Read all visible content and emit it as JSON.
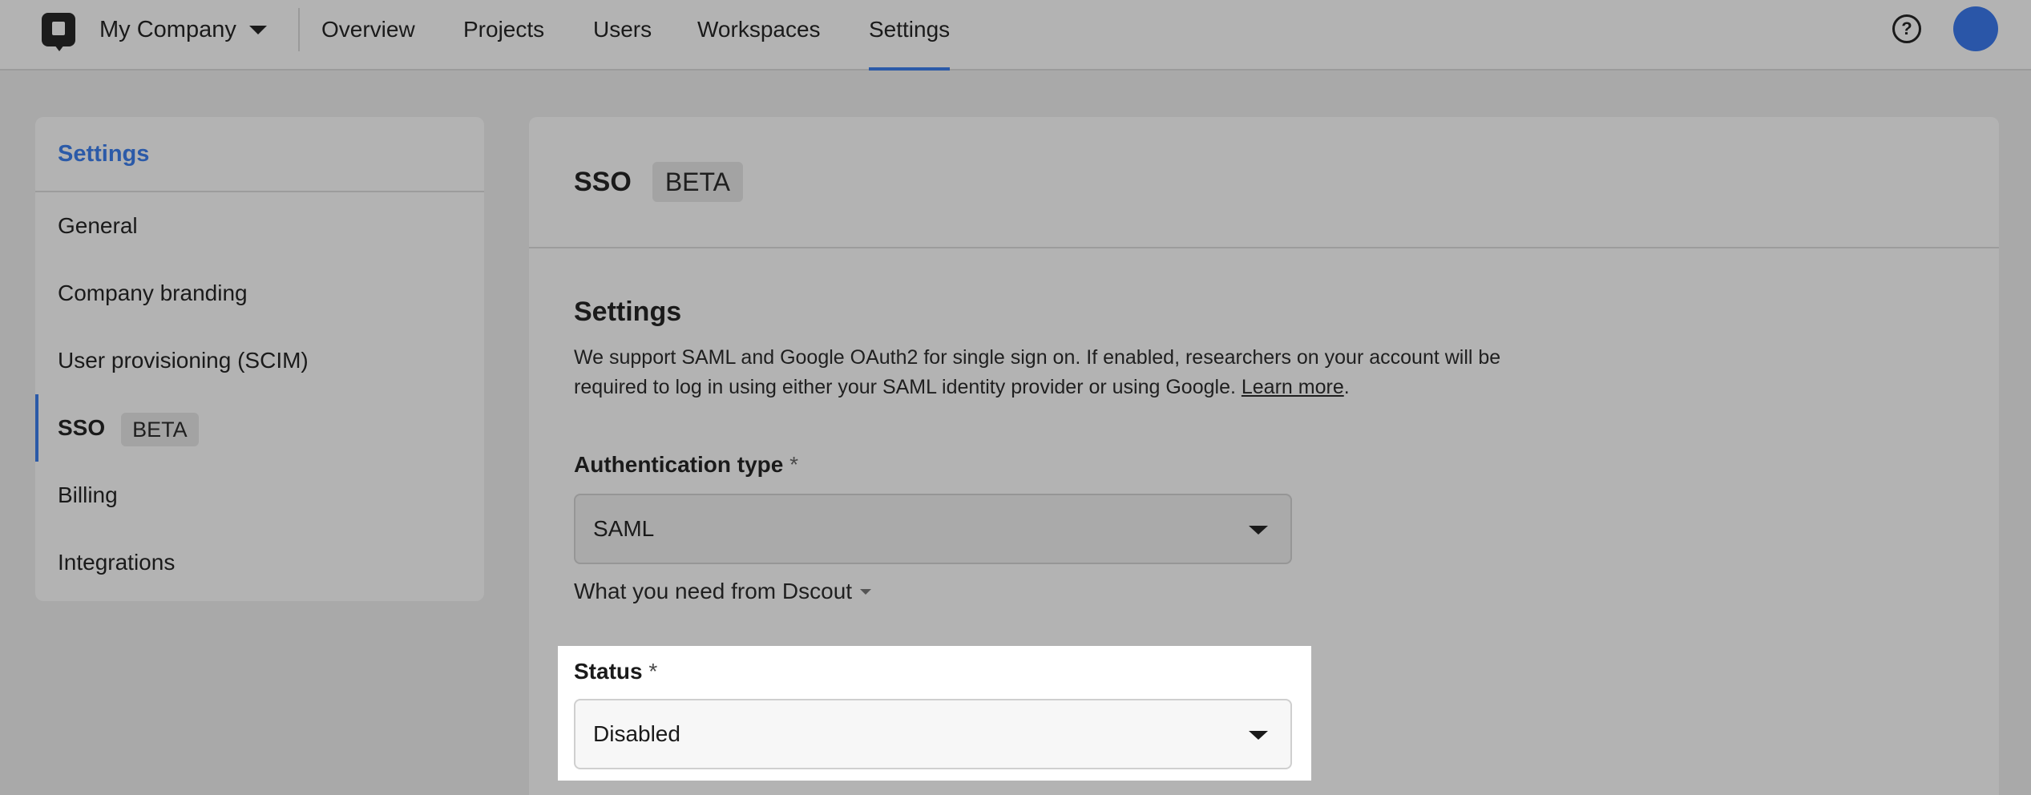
{
  "topnav": {
    "company": "My Company",
    "tabs": [
      {
        "label": "Overview"
      },
      {
        "label": "Projects"
      },
      {
        "label": "Users"
      },
      {
        "label": "Workspaces"
      },
      {
        "label": "Settings",
        "active": true
      }
    ],
    "help_glyph": "?"
  },
  "sidebar": {
    "title": "Settings",
    "items": [
      {
        "label": "General"
      },
      {
        "label": "Company branding"
      },
      {
        "label": "User provisioning (SCIM)"
      },
      {
        "label": "SSO",
        "badge": "BETA",
        "active": true
      },
      {
        "label": "Billing"
      },
      {
        "label": "Integrations"
      }
    ]
  },
  "main": {
    "title": "SSO",
    "badge": "BETA",
    "section_title": "Settings",
    "description": "We support SAML and Google OAuth2 for single sign on. If enabled, researchers on your account will be required to log in using either your SAML identity provider or using Google.",
    "learn_more": "Learn more",
    "auth_type": {
      "label": "Authentication type",
      "required": "*",
      "value": "SAML"
    },
    "disclosure": "What you need from Dscout",
    "status": {
      "label": "Status",
      "required": "*",
      "value": "Disabled"
    }
  },
  "colors": {
    "accent": "#2b5aa8",
    "avatar": "#2a56a8"
  }
}
